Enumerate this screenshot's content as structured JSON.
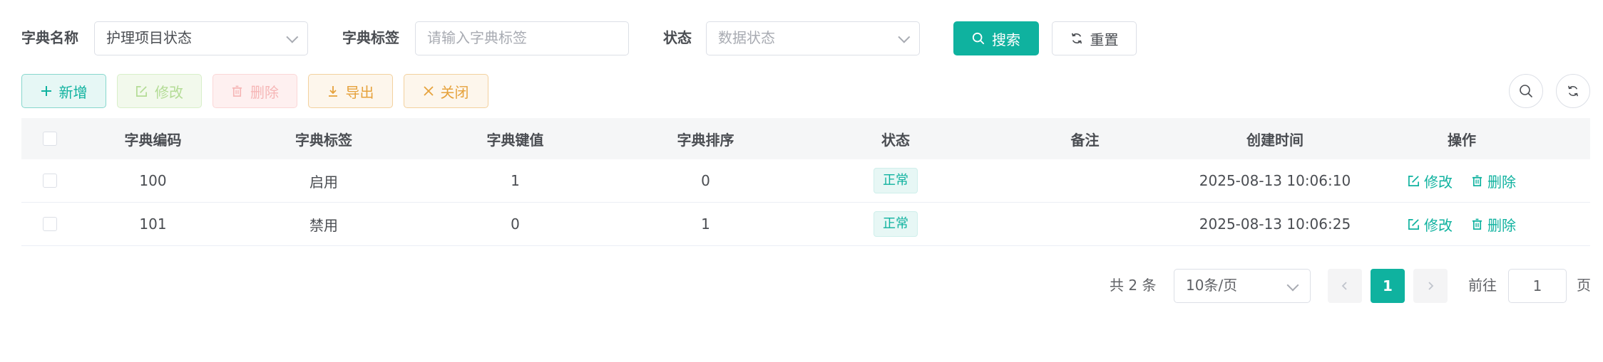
{
  "search": {
    "dict_name_label": "字典名称",
    "dict_name_value": "护理项目状态",
    "dict_label_label": "字典标签",
    "dict_label_placeholder": "请输入字典标签",
    "status_label": "状态",
    "status_placeholder": "数据状态",
    "search_button": "搜索",
    "reset_button": "重置"
  },
  "toolbar": {
    "add": "新增",
    "edit": "修改",
    "delete": "删除",
    "export": "导出",
    "close": "关闭"
  },
  "table": {
    "columns": [
      "字典编码",
      "字典标签",
      "字典键值",
      "字典排序",
      "状态",
      "备注",
      "创建时间",
      "操作"
    ],
    "rows": [
      {
        "code": "100",
        "label": "启用",
        "key": "1",
        "sort": "0",
        "status": "正常",
        "note": "",
        "created": "2025-08-13 10:06:10",
        "edit": "修改",
        "delete": "删除"
      },
      {
        "code": "101",
        "label": "禁用",
        "key": "0",
        "sort": "1",
        "status": "正常",
        "note": "",
        "created": "2025-08-13 10:06:25",
        "edit": "修改",
        "delete": "删除"
      }
    ]
  },
  "pagination": {
    "total_text": "共 2 条",
    "page_size": "10条/页",
    "current_page": "1",
    "goto_prefix": "前往",
    "goto_value": "1",
    "goto_suffix": "页"
  },
  "colors": {
    "primary": "#0fb29f",
    "success_light": "#b3dc95",
    "danger_light": "#f6b6b6",
    "warning": "#e6a23c"
  }
}
